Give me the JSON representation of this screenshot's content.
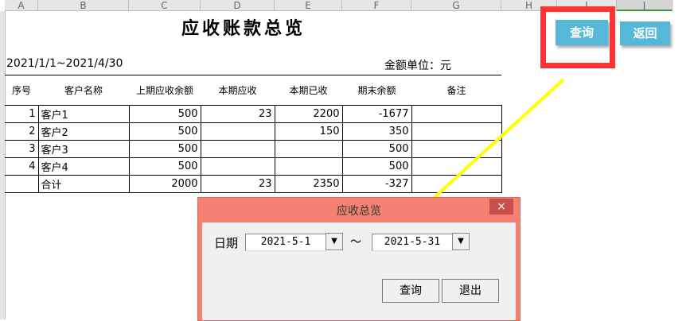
{
  "columns": [
    "A",
    "B",
    "C",
    "D",
    "E",
    "F",
    "G",
    "H",
    "I",
    "J"
  ],
  "sheet": {
    "title": "应收账款总览",
    "period": "2021/1/1~2021/4/30",
    "unit": "金额单位：元",
    "headers": [
      "序号",
      "客户名称",
      "上期应收余额",
      "本期应收",
      "本期已收",
      "期末余额",
      "备注"
    ],
    "rows": [
      [
        "1",
        "客户1",
        "500",
        "23",
        "2200",
        "-1677",
        ""
      ],
      [
        "2",
        "客户2",
        "500",
        "",
        "150",
        "350",
        ""
      ],
      [
        "3",
        "客户3",
        "500",
        "",
        "",
        "500",
        ""
      ],
      [
        "4",
        "客户4",
        "500",
        "",
        "",
        "500",
        ""
      ],
      [
        "",
        "合计",
        "2000",
        "23",
        "2350",
        "-327",
        ""
      ]
    ]
  },
  "buttons": {
    "query": "查询",
    "back": "返回"
  },
  "dialog": {
    "title": "应收总览",
    "close": "×",
    "date_label": "日期",
    "start": "2021-5-1",
    "tilde": "～",
    "end": "2021-5-31",
    "dropdown": "▼",
    "query": "查询",
    "exit": "退出"
  },
  "colors": {
    "button": "#55b8d6",
    "highlight": "#ff3333",
    "arrow": "#ffff00",
    "dialog": "#f48272"
  }
}
